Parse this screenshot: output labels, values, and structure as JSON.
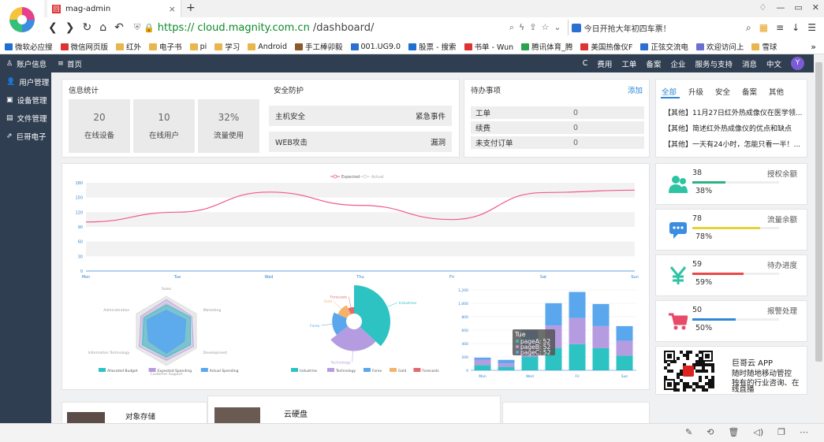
{
  "browser": {
    "tab_title": "mag-admin",
    "url_scheme": "https://",
    "url_host": "cloud.magnity.com.cn",
    "url_path": "/dashboard/",
    "search_text": "今日开抢大年初四车票！"
  },
  "bookmarks": [
    "微软必应搜",
    "微信网页版",
    "红外",
    "电子书",
    "pi",
    "学习",
    "Android",
    "手工棒卯毅",
    "001.UG9.0",
    "股票 - 搜索",
    "书单 - Wun",
    "腾讯体育_腾",
    "美国热像仪F",
    "正弦交流电",
    "欢迎访问上",
    "雪球"
  ],
  "sidebar": {
    "items": [
      {
        "label": "账户信息",
        "icon": "bank-icon"
      },
      {
        "label": "用户管理",
        "icon": "user-icon"
      },
      {
        "label": "设备管理",
        "icon": "device-icon"
      },
      {
        "label": "文件管理",
        "icon": "file-icon"
      },
      {
        "label": "巨哥电子",
        "icon": "external-link-icon"
      }
    ]
  },
  "topbar": {
    "home": "首页",
    "menu": [
      "费用",
      "工单",
      "备案",
      "企业",
      "服务与支持",
      "消息",
      "中文"
    ],
    "avatar": "Y"
  },
  "info_stats": {
    "title": "信息统计",
    "items": [
      {
        "value": "20",
        "label": "在线设备"
      },
      {
        "value": "10",
        "label": "在线用户"
      },
      {
        "value": "32%",
        "label": "流量使用"
      }
    ]
  },
  "security": {
    "title": "安全防护",
    "rows": [
      {
        "left": "主机安全",
        "right": "紧急事件"
      },
      {
        "left": "WEB攻击",
        "right": "漏洞"
      }
    ]
  },
  "todos": {
    "title": "待办事项",
    "add": "添加",
    "items": [
      {
        "label": "工单",
        "count": "0"
      },
      {
        "label": "续费",
        "count": "0"
      },
      {
        "label": "未支付订单",
        "count": "0"
      }
    ]
  },
  "news": {
    "tabs": [
      "全部",
      "升级",
      "安全",
      "备案",
      "其他"
    ],
    "items": [
      "【其他】11月27日红外热成像仪在医学领...",
      "【其他】简述红外热成像仪的优点和缺点",
      "【其他】一天有24小时，怎能只看一半！..."
    ]
  },
  "metrics": [
    {
      "num": "38",
      "label": "授权余额",
      "pct": "38%",
      "value": 0.38,
      "color": "#2cb27f",
      "icon": "users-icon"
    },
    {
      "num": "78",
      "label": "流量余额",
      "pct": "78%",
      "value": 0.78,
      "color": "#e6d23a",
      "icon": "chat-icon"
    },
    {
      "num": "59",
      "label": "待办进度",
      "pct": "59%",
      "value": 0.59,
      "color": "#e84a4a",
      "icon": "yen-icon"
    },
    {
      "num": "50",
      "label": "报警处理",
      "pct": "50%",
      "value": 0.5,
      "color": "#2f86d6",
      "icon": "cart-icon"
    }
  ],
  "app_promo": {
    "title": "巨哥云 APP",
    "line1": "随时随地移动管控",
    "line2": "独有的行业咨询、在",
    "line3": "线直播"
  },
  "bottom": {
    "card1_title": "对象存储",
    "card2_title": "云硬盘"
  },
  "chart_data": [
    {
      "type": "line",
      "legend": [
        "Expected",
        "Actual"
      ],
      "categories": [
        "Mon",
        "Tue",
        "Wed",
        "Thu",
        "Fri",
        "Sat",
        "Sun"
      ],
      "ylim": [
        0,
        180
      ],
      "yticks": [
        0,
        30,
        60,
        90,
        120,
        150,
        180
      ],
      "series": [
        {
          "name": "Expected",
          "values": [
            100,
            120,
            161,
            134,
            105,
            160,
            165
          ],
          "color": "#f05b8a"
        }
      ]
    },
    {
      "type": "radar",
      "indicators": [
        "Sales",
        "Marketing",
        "Development",
        "Customer Support",
        "Information Technology",
        "Administration"
      ],
      "legend": [
        "Allocated Budget",
        "Expected Spending",
        "Actual Spending"
      ],
      "colors": [
        "#2ec3c3",
        "#b59be0",
        "#5aa7ee"
      ]
    },
    {
      "type": "pie",
      "categories": [
        "Industries",
        "Technology",
        "Forex",
        "Gold",
        "Forecasts"
      ],
      "values": [
        320,
        240,
        149,
        100,
        59
      ],
      "colors": [
        "#2ec3c3",
        "#b59be0",
        "#5aa7ee",
        "#f4b26b",
        "#e36a6a"
      ]
    },
    {
      "type": "bar",
      "categories": [
        "Mon",
        "Tue",
        "Wed",
        "Thu",
        "Fri",
        "Sat",
        "Sun"
      ],
      "ylim": [
        0,
        1200
      ],
      "yticks": [
        0,
        200,
        400,
        600,
        800,
        1000,
        1200
      ],
      "series": [
        {
          "name": "pageA",
          "values": [
            79,
            52,
            200,
            334,
            390,
            330,
            220
          ],
          "color": "#2ec3c3"
        },
        {
          "name": "pageB",
          "values": [
            80,
            52,
            200,
            334,
            390,
            330,
            220
          ],
          "color": "#b59be0"
        },
        {
          "name": "pageC",
          "values": [
            30,
            52,
            200,
            334,
            390,
            330,
            220
          ],
          "color": "#5aa7ee"
        }
      ],
      "tooltip": {
        "title": "Tue",
        "lines": [
          "pageA: 52",
          "pageB: 52",
          "pageC: 52"
        ]
      }
    }
  ]
}
